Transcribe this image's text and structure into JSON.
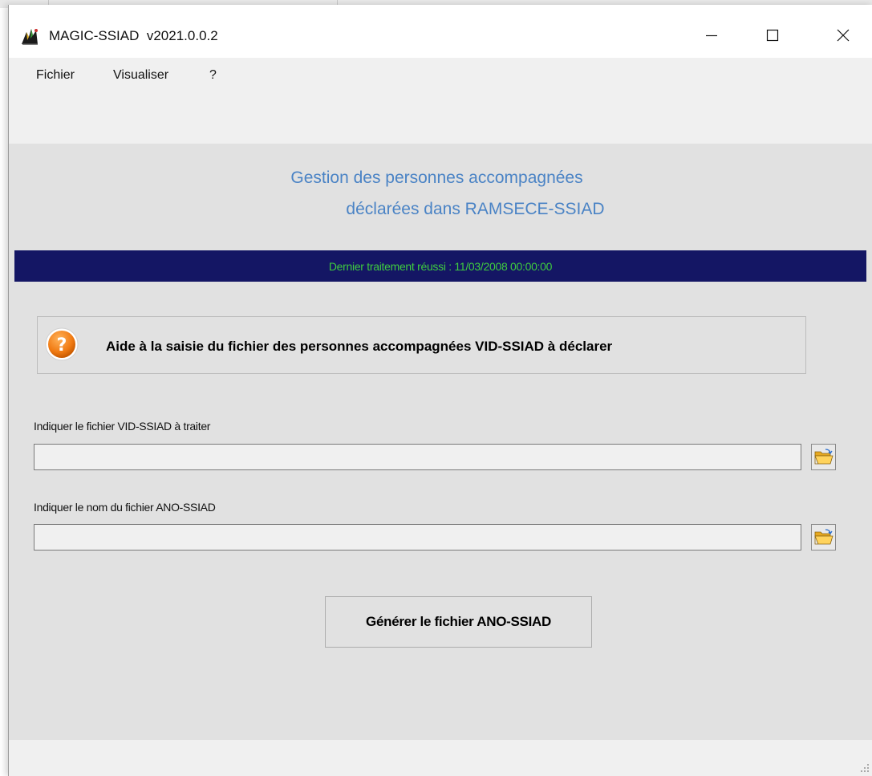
{
  "window": {
    "title": "MAGIC-SSIAD  v2021.0.0.2"
  },
  "menu": {
    "items": [
      "Fichier",
      "Visualiser",
      "?"
    ]
  },
  "header": {
    "line1": "Gestion des personnes accompagnées",
    "line2": "déclarées dans RAMSECE-SSIAD",
    "color": "#4a83c5"
  },
  "status": {
    "text": "Dernier traitement réussi : 11/03/2008 00:00:00",
    "background": "#141664",
    "color": "#3fcc3f"
  },
  "help": {
    "icon": "question-icon",
    "text": "Aide à la saisie du fichier des personnes accompagnées VID-SSIAD à déclarer"
  },
  "fields": {
    "vid": {
      "label": "Indiquer le fichier VID-SSIAD à traiter",
      "value": "",
      "browse_icon": "folder-open-icon"
    },
    "ano": {
      "label": "Indiquer le nom du fichier ANO-SSIAD",
      "value": "",
      "browse_icon": "folder-open-icon"
    }
  },
  "actions": {
    "generate_label": "Générer le fichier ANO-SSIAD"
  }
}
